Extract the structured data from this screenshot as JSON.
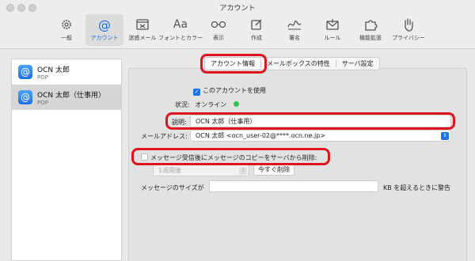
{
  "window": {
    "title": "アカウント"
  },
  "toolbar": {
    "items": [
      {
        "label": "一般",
        "icon": "gear-icon"
      },
      {
        "label": "アカウント",
        "icon": "at-icon",
        "active": true
      },
      {
        "label": "迷惑メール",
        "icon": "junk-icon"
      },
      {
        "label": "フォントとカラー",
        "icon": "font-icon",
        "glyph": "Aa"
      },
      {
        "label": "表示",
        "icon": "glasses-icon"
      },
      {
        "label": "作成",
        "icon": "compose-icon"
      },
      {
        "label": "署名",
        "icon": "signature-icon"
      },
      {
        "label": "ルール",
        "icon": "rules-icon"
      },
      {
        "label": "機能拡張",
        "icon": "puzzle-icon"
      },
      {
        "label": "プライバシー",
        "icon": "hand-icon"
      }
    ]
  },
  "sidebar": {
    "accounts": [
      {
        "name": "OCN 太郎",
        "type": "POP",
        "selected": false
      },
      {
        "name": "OCN 太郎（仕事用）",
        "type": "POP",
        "selected": true
      }
    ]
  },
  "tabs": [
    {
      "label": "アカウント情報",
      "active": true
    },
    {
      "label": "メールボックスの特性"
    },
    {
      "label": "サーバ設定"
    }
  ],
  "form": {
    "enable_label": "このアカウントを使用",
    "enabled": true,
    "status_label": "状況:",
    "status_value": "オンライン",
    "status_color": "#30c44a",
    "description_label": "説明:",
    "description_value": "OCN 太郎（仕事用）",
    "email_label": "メールアドレス:",
    "email_value": "OCN 太郎 <ocn_user-02@****.ocn.ne.jp>",
    "delete_label": "メッセージ受信後にメッセージのコピーをサーバから削除:",
    "delete_checked": false,
    "delete_period": "1週間後",
    "delete_now": "今すぐ削除",
    "size_label": "メッセージのサイズが",
    "size_value": "",
    "size_suffix": "KB を超えるときに警告"
  },
  "colors": {
    "accent": "#1a73e8",
    "highlight": "#e0141e"
  }
}
